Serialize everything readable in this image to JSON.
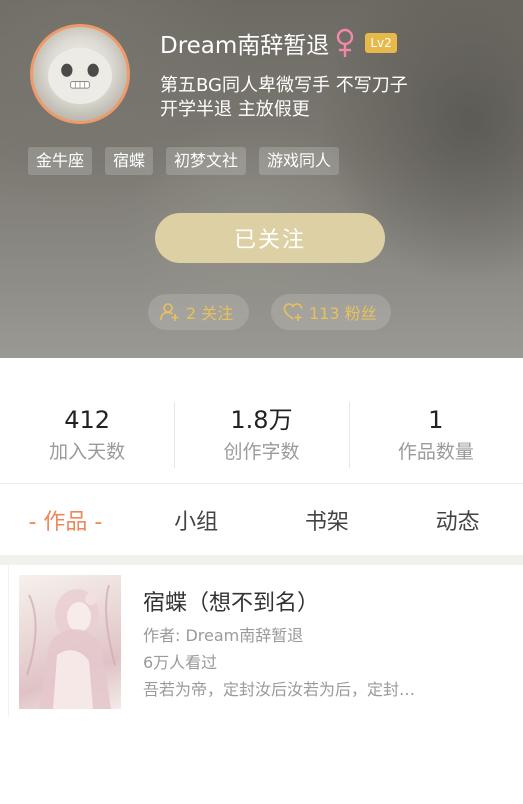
{
  "profile": {
    "username": "Dream南辞暂退",
    "gender_icon": "female-icon",
    "level": "Lv2",
    "bio_lines": [
      "第五BG同人卑微写手 不写刀子",
      "开学半退 主放假更"
    ],
    "tags": [
      "金牛座",
      "宿蝶",
      "初梦文社",
      "游戏同人"
    ],
    "follow_button_label": "已关注",
    "following_label": "2 关注",
    "fans_label": "113 粉丝"
  },
  "stats": [
    {
      "value": "412",
      "label": "加入天数"
    },
    {
      "value": "1.8万",
      "label": "创作字数"
    },
    {
      "value": "1",
      "label": "作品数量"
    }
  ],
  "tabs": [
    {
      "label": "- 作品 -",
      "active": true
    },
    {
      "label": "小组",
      "active": false
    },
    {
      "label": "书架",
      "active": false
    },
    {
      "label": "动态",
      "active": false
    }
  ],
  "works": [
    {
      "title": "宿蝶（想不到名）",
      "author": "作者: Dream南辞暂退",
      "views": "6万人看过",
      "excerpt": "吾若为帝，定封汝后汝若为后，定封…"
    }
  ],
  "colors": {
    "accent": "#f0875a",
    "gold": "#e7c25c",
    "level_badge": "#e7b84a",
    "follow_button": "#ddd0a4",
    "female_icon": "#f08aa8"
  }
}
